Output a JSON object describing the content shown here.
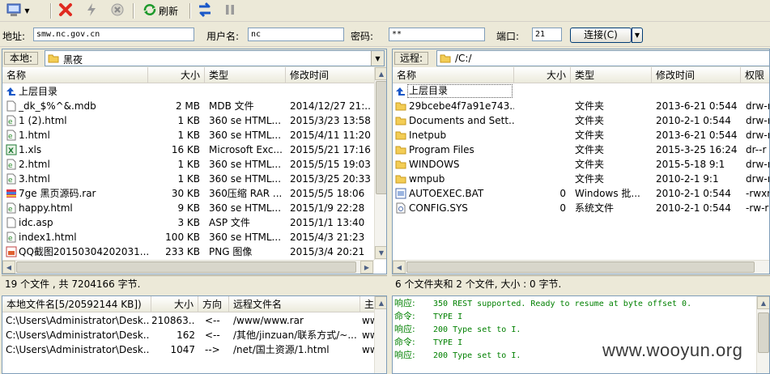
{
  "connection": {
    "address_label": "地址:",
    "address_value": "smw.nc.gov.cn",
    "user_label": "用户名:",
    "user_value": "nc",
    "password_label": "密码:",
    "password_value": "**",
    "port_label": "端口:",
    "port_value": "21",
    "connect_label": "连接(C)"
  },
  "toolbar": {
    "refresh_label": "刷新"
  },
  "local": {
    "path_label": "本地:",
    "path_value": "黑夜",
    "columns": [
      "名称",
      "大小",
      "类型",
      "修改时间"
    ],
    "parent_dir": "上层目录",
    "files": [
      {
        "name": "_dk_$%^&.mdb",
        "size": "2 MB",
        "type": "MDB 文件",
        "mtime": "2014/12/27 21:..",
        "icon": "blank-file"
      },
      {
        "name": "1 (2).html",
        "size": "1 KB",
        "type": "360 se HTML...",
        "mtime": "2015/3/23 13:58",
        "icon": "html-file"
      },
      {
        "name": "1.html",
        "size": "1 KB",
        "type": "360 se HTML...",
        "mtime": "2015/4/11 11:20",
        "icon": "html-file"
      },
      {
        "name": "1.xls",
        "size": "16 KB",
        "type": "Microsoft Exc...",
        "mtime": "2015/5/21 17:16",
        "icon": "excel-file"
      },
      {
        "name": "2.html",
        "size": "1 KB",
        "type": "360 se HTML...",
        "mtime": "2015/5/15 19:03",
        "icon": "html-file"
      },
      {
        "name": "3.html",
        "size": "1 KB",
        "type": "360 se HTML...",
        "mtime": "2015/3/25 20:33",
        "icon": "html-file"
      },
      {
        "name": "7ge 黑页源码.rar",
        "size": "30 KB",
        "type": "360压缩 RAR ...",
        "mtime": "2015/5/5 18:06",
        "icon": "rar-file"
      },
      {
        "name": "happy.html",
        "size": "9 KB",
        "type": "360 se HTML...",
        "mtime": "2015/1/9 22:28",
        "icon": "html-file"
      },
      {
        "name": "idc.asp",
        "size": "3 KB",
        "type": "ASP 文件",
        "mtime": "2015/1/1 13:40",
        "icon": "blank-file"
      },
      {
        "name": "index1.html",
        "size": "100 KB",
        "type": "360 se HTML...",
        "mtime": "2015/4/3 21:23",
        "icon": "html-file"
      },
      {
        "name": "QQ截图20150304202031...",
        "size": "233 KB",
        "type": "PNG 图像",
        "mtime": "2015/3/4 20:21",
        "icon": "image-file"
      }
    ],
    "status": "19 个文件 , 共 7204166 字节."
  },
  "remote": {
    "path_label": "远程:",
    "path_value": "/C:/",
    "columns": [
      "名称",
      "大小",
      "类型",
      "修改时间",
      "权限"
    ],
    "parent_dir": "上层目录",
    "files": [
      {
        "name": "29bcebe4f7a91e743...",
        "size": "",
        "type": "文件夹",
        "mtime": "2013-6-21 0:544",
        "perm": "drw-r",
        "icon": "folder"
      },
      {
        "name": "Documents and Sett...",
        "size": "",
        "type": "文件夹",
        "mtime": "2010-2-1 0:544",
        "perm": "drw-r",
        "icon": "folder"
      },
      {
        "name": "Inetpub",
        "size": "",
        "type": "文件夹",
        "mtime": "2013-6-21 0:544",
        "perm": "drw-r",
        "icon": "folder"
      },
      {
        "name": "Program Files",
        "size": "",
        "type": "文件夹",
        "mtime": "2015-3-25 16:24",
        "perm": "dr--r",
        "icon": "folder"
      },
      {
        "name": "WINDOWS",
        "size": "",
        "type": "文件夹",
        "mtime": "2015-5-18 9:1",
        "perm": "drw-r",
        "icon": "folder"
      },
      {
        "name": "wmpub",
        "size": "",
        "type": "文件夹",
        "mtime": "2010-2-1 9:1",
        "perm": "drw-r",
        "icon": "folder"
      },
      {
        "name": "AUTOEXEC.BAT",
        "size": "0",
        "type": "Windows 批...",
        "mtime": "2010-2-1 0:544",
        "perm": "-rwxr",
        "icon": "bat-file"
      },
      {
        "name": "CONFIG.SYS",
        "size": "0",
        "type": "系统文件",
        "mtime": "2010-2-1 0:544",
        "perm": "-rw-r",
        "icon": "sys-file"
      }
    ],
    "status": "6 个文件夹和 2 个文件, 大小 : 0 字节."
  },
  "queue": {
    "columns": [
      "本地文件名[5/20592144 KB])",
      "大小",
      "方向",
      "远程文件名",
      "主"
    ],
    "rows": [
      {
        "local": "C:\\Users\\Administrator\\Desk...",
        "size": "210863...",
        "dir": "<--",
        "remote": "/www/www.rar",
        "extra": "ww"
      },
      {
        "local": "C:\\Users\\Administrator\\Desk...",
        "size": "162",
        "dir": "<--",
        "remote": "/其他/jinzuan/联系方式/~...",
        "extra": "ww"
      },
      {
        "local": "C:\\Users\\Administrator\\Desk...",
        "size": "1047",
        "dir": "-->",
        "remote": "/net/国土资源/1.html",
        "extra": "ww"
      }
    ]
  },
  "log": [
    {
      "k": "响应:",
      "v": "350 REST supported. Ready to resume at byte offset 0."
    },
    {
      "k": "命令:",
      "v": "TYPE I"
    },
    {
      "k": "响应:",
      "v": "200 Type set to I."
    },
    {
      "k": "命令:",
      "v": "TYPE I"
    },
    {
      "k": "响应:",
      "v": "200 Type set to I."
    }
  ],
  "watermark": "www.wooyun.org"
}
